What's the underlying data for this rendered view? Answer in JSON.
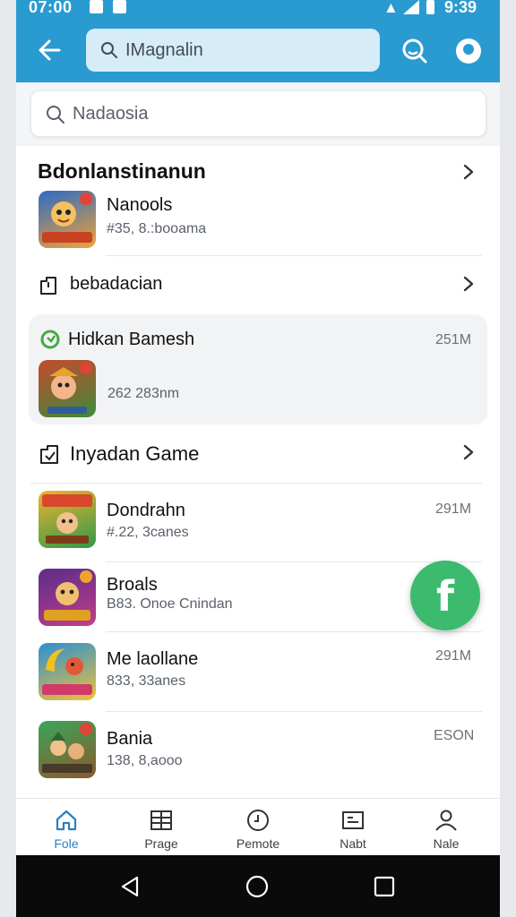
{
  "status_bar": {
    "time_left": "07:00",
    "time_right": "9:39"
  },
  "top_search": {
    "value": "IMagnalin"
  },
  "secondary_search": {
    "value": "Nadaosia"
  },
  "section1": {
    "title": "Bdonlanstinanun",
    "items": [
      {
        "name": "Nanools",
        "sub": "#35, 8.:booama",
        "icon": "game-app-icon"
      }
    ]
  },
  "link_row1": {
    "label": "bebadacian"
  },
  "highlight": {
    "name": "Hidkan Bamesh",
    "size": "251M",
    "sub": "262  283nm"
  },
  "section2": {
    "title": "Inyadan Game",
    "items": [
      {
        "name": "Dondrahn",
        "sub": "#.22, 3canes",
        "size": "291M"
      },
      {
        "name": "Broals",
        "sub": "B83. Onoe Cnindan",
        "size": ""
      },
      {
        "name": "Me laollane",
        "sub": "833, 33anes",
        "size": "291M"
      },
      {
        "name": "Bania",
        "sub": "138, 8,aooo",
        "size": "ESON"
      }
    ]
  },
  "fab": {
    "label": "f"
  },
  "bottom_nav": [
    {
      "label": "Fole",
      "icon": "home-icon",
      "active": true
    },
    {
      "label": "Prage",
      "icon": "grid-icon",
      "active": false
    },
    {
      "label": "Pemote",
      "icon": "clock-icon",
      "active": false
    },
    {
      "label": "Nabt",
      "icon": "list-icon",
      "active": false
    },
    {
      "label": "Nale",
      "icon": "person-icon",
      "active": false
    }
  ],
  "colors": {
    "primary": "#2a9bd0",
    "fab": "#3cba6e",
    "active_nav": "#2a7fc0"
  }
}
